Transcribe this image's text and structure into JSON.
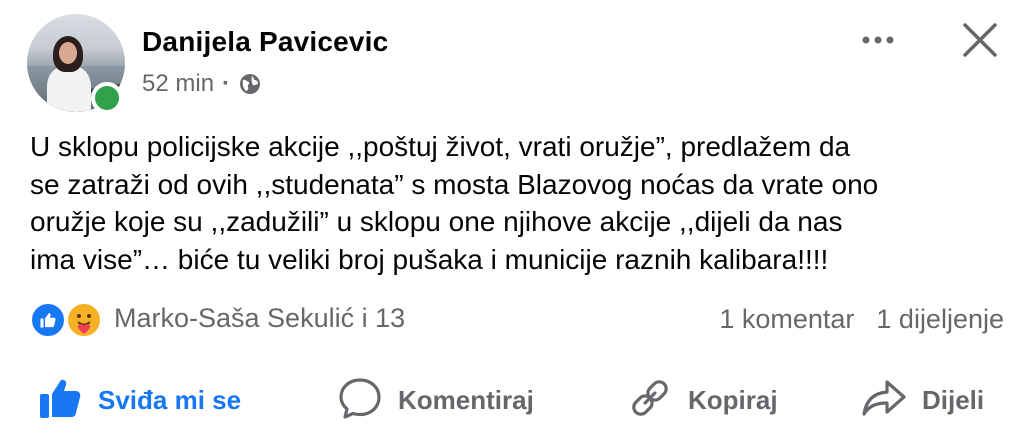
{
  "post": {
    "author": "Danijela Pavicevic",
    "time": "52 min",
    "separator": "·",
    "audience_icon": "globe-icon",
    "text": ",,U sklopu policijske akcije ,,poštuj život, vrati oružje”, predlažem da se zatraži od ovih ,,studenata” s mosta Blazovog noćas da vrate ono oružje koje su ,,zadužili” u sklopu one njihove akcije ,,dijeli da nas ima vise”… biće tu veliki broj pušaka i municije raznih kalibara!!!!",
    "text_lines": [
      "U sklopu policijske akcije ,,poštuj život, vrati oružje”, predlažem da",
      "se zatraži od ovih ,,studenata” s mosta Blazovog noćas da vrate ono",
      "oružje koje su ,,zadužili” u sklopu one njihove akcije ,,dijeli da nas",
      "ima vise”… biće tu veliki broj pušaka i municije raznih kalibara!!!!"
    ]
  },
  "header": {
    "more_icon": "more-horizontal-icon",
    "close_icon": "close-icon"
  },
  "reactions": {
    "icons": [
      "like-reaction-icon",
      "care-reaction-icon"
    ],
    "names": "Marko-Saša Sekulić i 13"
  },
  "counts": {
    "comments": "1 komentar",
    "shares": "1 dijeljenje"
  },
  "actions": {
    "like_label": "Sviđa mi se",
    "comment_label": "Komentiraj",
    "copy_label": "Kopiraj",
    "share_label": "Dijeli"
  },
  "colors": {
    "accent": "#1877f2",
    "online": "#31a24c",
    "secondary_text": "#65676b"
  }
}
